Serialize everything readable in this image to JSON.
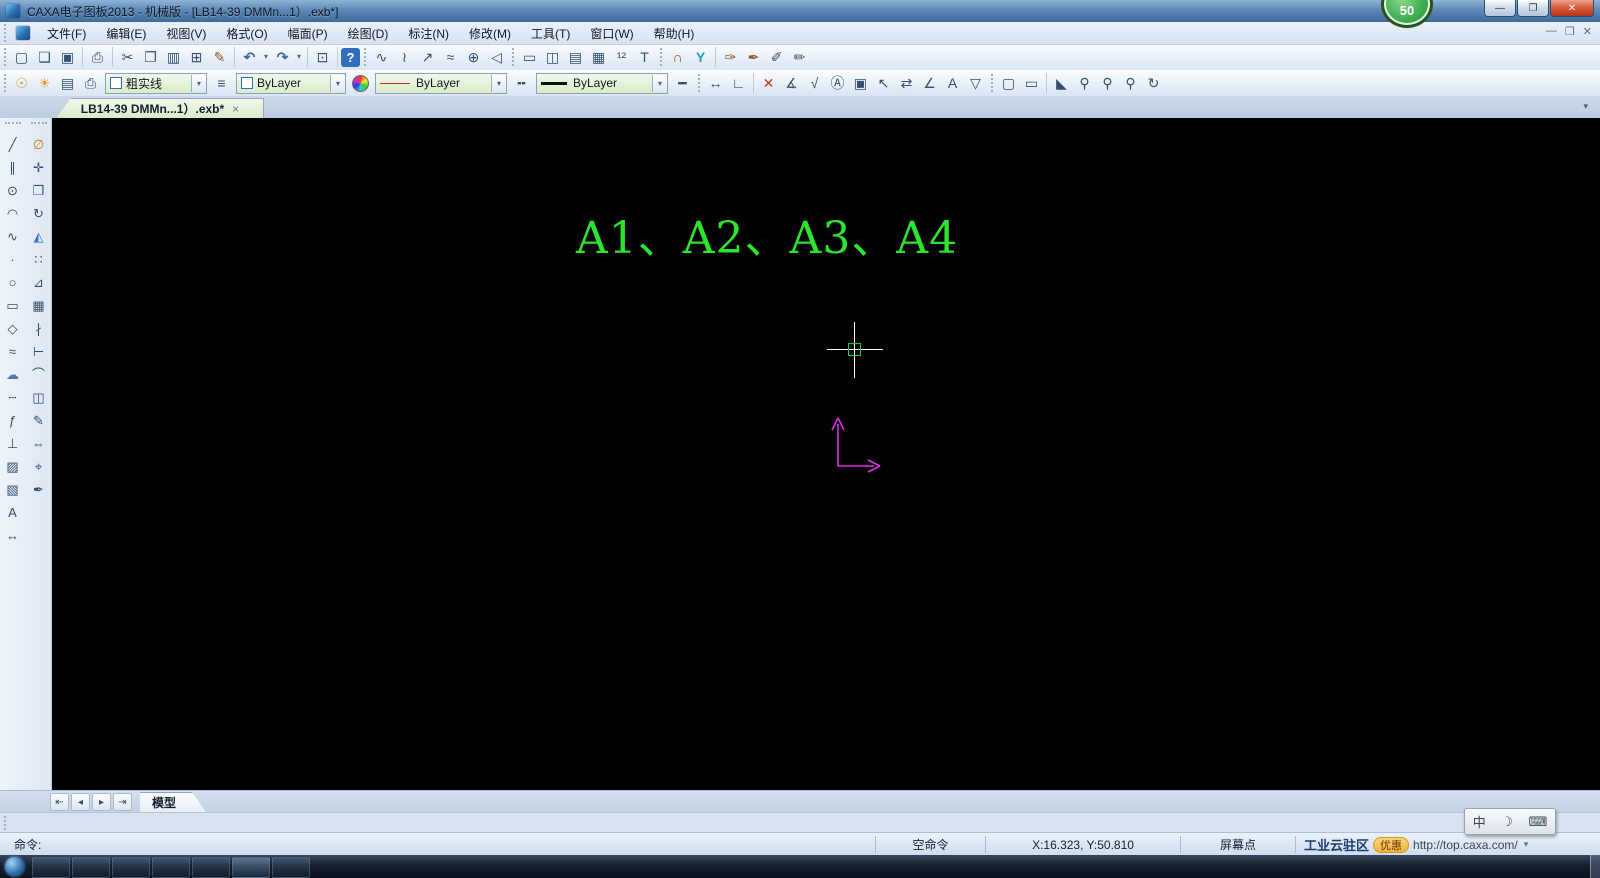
{
  "window": {
    "title": "CAXA电子图板2013 - 机械版 - [LB14-39 DMMn...1）.exb*]",
    "badge": "50",
    "minimize": "—",
    "restore": "❐",
    "close": "✕"
  },
  "menubar": {
    "items": [
      "文件(F)",
      "编辑(E)",
      "视图(V)",
      "格式(O)",
      "幅面(P)",
      "绘图(D)",
      "标注(N)",
      "修改(M)",
      "工具(T)",
      "窗口(W)",
      "帮助(H)"
    ],
    "mdi_minimize": "—",
    "mdi_restore": "❐",
    "mdi_close": "✕"
  },
  "toolbar2": {
    "layer_value": "粗实线",
    "color_value": "ByLayer",
    "linetype_value": "ByLayer",
    "lineweight_value": "ByLayer",
    "arrow": "▾"
  },
  "doctab": {
    "label": "LB14-39 DMMn...1）.exb*",
    "close": "×",
    "overflow": "▾"
  },
  "canvas": {
    "annotation": "A1、A2、A3、A4",
    "annotation_color": "#2ee52e",
    "cursor_color": "#ffffff",
    "pickbox_color": "#19c94f",
    "axis_color": "#e22ee2"
  },
  "sheetbar": {
    "nav_first": "⇤",
    "nav_prev": "◂",
    "nav_next": "▸",
    "nav_last": "⇥",
    "tab": "模型"
  },
  "statusbar": {
    "command_label": "命令:",
    "empty_command": "空命令",
    "coordinates": "X:16.323, Y:50.810",
    "point_mode": "屏幕点",
    "cloud_text": "工业云驻区",
    "promo_badge": "优惠",
    "cloud_url": "http://top.caxa.com/",
    "caret": "▾"
  },
  "ime": {
    "lang": "中",
    "fullwidth": "☽",
    "keyboard": "⌨"
  },
  "icons": {
    "new": "▢",
    "open": "❏",
    "save": "▣",
    "print": "⎙",
    "cut": "✂",
    "copy": "❐",
    "copy_base": "▥",
    "paste": "⊞",
    "format_brush": "✎",
    "undo": "↶",
    "redo": "↷",
    "caret": "▾",
    "ole": "⊡",
    "help": "?",
    "wave": "∿",
    "node_curve": "≀",
    "leader_arrow": "↗",
    "lasso": "≈",
    "local_zoom": "⊕",
    "cone": "◁",
    "frame": "▭",
    "frame_edit": "◫",
    "titleblock": "▤",
    "param_table": "▦",
    "serial": "¹²",
    "bom": "T",
    "magnet": "∩",
    "split": "Y",
    "brush1": "✑",
    "brush2": "✒",
    "shape_edit": "✐",
    "note_edit": "✏",
    "bulb": "☉",
    "sun": "☀",
    "layer_toggle": "▤",
    "layer_print": "⎙",
    "layer_tool": "≡",
    "linetype_tool": "╍",
    "lineweight_tool": "━",
    "dim1": "↔",
    "dim2": "∟",
    "dim3": "✕",
    "dim4": "∡",
    "dim5": "√",
    "dim6": "Ⓐ",
    "dim7": "▣",
    "dim8": "↖",
    "dim9": "⇄",
    "dim10": "∠",
    "dim11": "A",
    "dim12": "▽",
    "view_screen": "▢",
    "view_ruler": "▭",
    "wipe": "◣",
    "zoom": "⚲",
    "zoom_win": "⚲",
    "zoom_all": "⚲",
    "zoom_prev": "↻",
    "l_line": "╱",
    "l_parallel": "∥",
    "l_circle": "⊙",
    "l_arc": "◠",
    "l_spline": "∿",
    "l_point": "·",
    "l_ellipse": "○",
    "l_rect": "▭",
    "l_polygon": "◇",
    "l_wave": "≈",
    "l_cloud": "☁",
    "l_construction": "┄",
    "l_formula": "ƒ",
    "l_axis": "⊥",
    "l_hatch": "▨",
    "l_profile": "▧",
    "l_text": "A",
    "l_dim": "↔",
    "m_erase": "∅",
    "m_move": "✛",
    "m_copy": "❒",
    "m_rotate": "↻",
    "m_mirror": "◭",
    "m_array": "∷",
    "m_scale": "⊿",
    "m_crop": "▦",
    "m_break": "∤",
    "m_extend": "⊢",
    "m_fillet": "⌒",
    "m_view3d": "◫",
    "m_editdim": "✎",
    "m_stretch": "⇔",
    "m_pick": "⌖",
    "m_style": "✒"
  }
}
